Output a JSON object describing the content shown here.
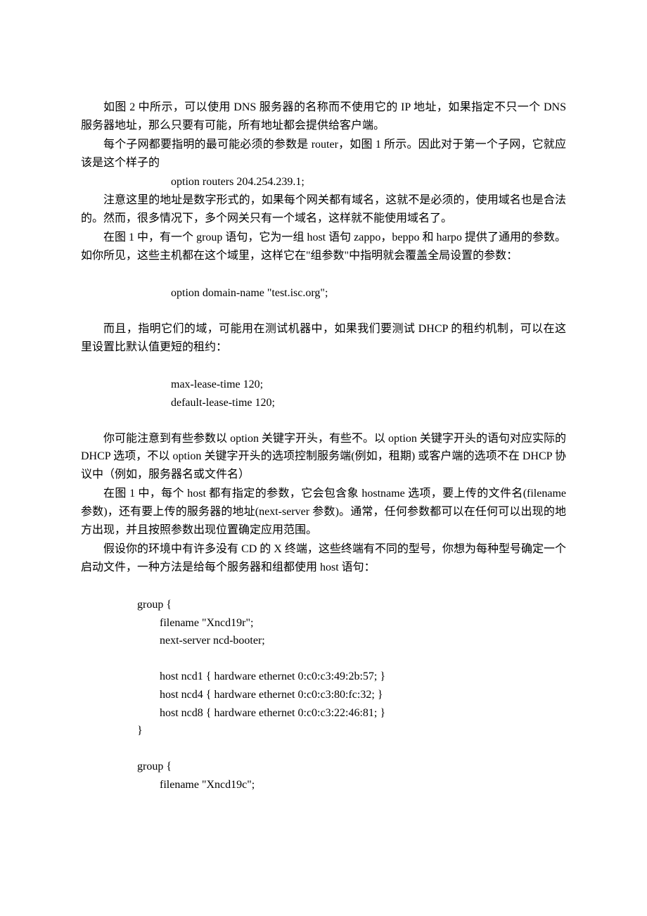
{
  "paragraphs": {
    "p1": "如图 2 中所示，可以使用 DNS 服务器的名称而不使用它的 IP 地址，如果指定不只一个 DNS 服务器地址，那么只要有可能，所有地址都会提供给客户端。",
    "p2": "每个子网都要指明的最可能必须的参数是 router，如图 1 所示。因此对于第一个子网，它就应该是这个样子的",
    "code1": "option routers 204.254.239.1;",
    "p3": "注意这里的地址是数字形式的，如果每个网关都有域名，这就不是必须的，使用域名也是合法的。然而，很多情况下，多个网关只有一个域名，这样就不能使用域名了。",
    "p4": "在图 1 中，有一个 group  语句，它为一组 host 语句 zappo，beppo 和 harpo 提供了通用的参数。如你所见，这些主机都在这个域里，这样它在\"组参数\"中指明就会覆盖全局设置的参数：",
    "code2": "option domain-name \"test.isc.org\";",
    "p5": "而且，指明它们的域，可能用在测试机器中，如果我们要测试 DHCP 的租约机制，可以在这里设置比默认值更短的租约：",
    "code3a": "max-lease-time 120;",
    "code3b": "default-lease-time 120;",
    "p6": "你可能注意到有些参数以 option  关键字开头，有些不。以 option  关键字开头的语句对应实际的 DHCP 选项，不以 option 关键字开头的选项控制服务端(例如，租期) 或客户端的选项不在 DHCP 协议中（例如，服务器名或文件名）",
    "p7": "在图 1 中，每个 host  都有指定的参数，它会包含象 hostname 选项，要上传的文件名(filename  参数)，还有要上传的服务器的地址(next-server  参数)。通常，任何参数都可以在任何可以出现的地方出现，并且按照参数出现位置确定应用范围。",
    "p8": "假设你的环境中有许多没有 CD 的 X 终端，这些终端有不同的型号，你想为每种型号确定一个启动文件，一种方法是给每个服务器和组都使用 host 语句：",
    "g1_open": "group {",
    "g1_l1": "filename \"Xncd19r\";",
    "g1_l2": "next-server ncd-booter;",
    "g1_l3": "host ncd1 { hardware ethernet 0:c0:c3:49:2b:57; }",
    "g1_l4": "host ncd4 { hardware ethernet 0:c0:c3:80:fc:32; }",
    "g1_l5": "host ncd8 { hardware ethernet 0:c0:c3:22:46:81; }",
    "g1_close": "}",
    "g2_open": "group {",
    "g2_l1": "filename \"Xncd19c\";"
  }
}
